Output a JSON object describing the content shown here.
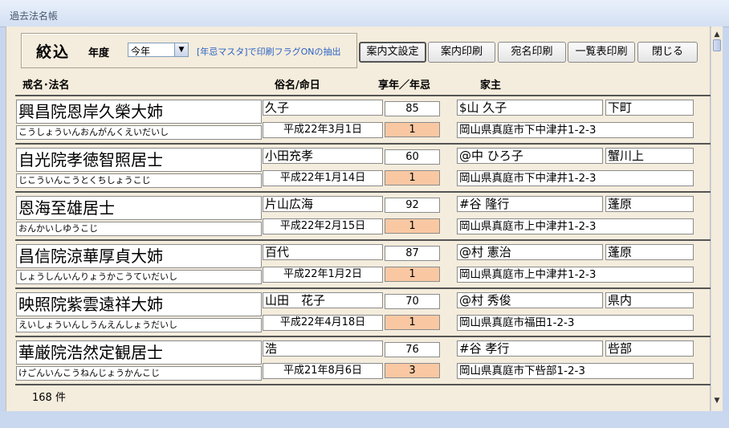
{
  "window": {
    "title": "過去法名帳"
  },
  "filter": {
    "title": "絞込",
    "year_label": "年度",
    "year_value": "今年",
    "link": "[年忌マスタ]で印刷フラグONの抽出"
  },
  "buttons": {
    "guide_settings": "案内文設定",
    "guide_print": "案内印刷",
    "address_print": "宛名印刷",
    "list_print": "一覧表印刷",
    "close": "閉じる"
  },
  "columns": {
    "kaimyo": "戒名･法名",
    "zokumyo": "俗名/命日",
    "age_nenki": "享年／年忌",
    "kachu": "家主"
  },
  "records": [
    {
      "kaimyo": "興昌院恩岸久榮大姉",
      "kana": "こうしょういんおんがんくえいだいし",
      "zokumyo": "久子",
      "meinichi": "平成22年3月1日",
      "age": "85",
      "nenki": "1",
      "kachu": "$山 久子",
      "area": "下町",
      "address": "岡山県真庭市下中津井1-2-3"
    },
    {
      "kaimyo": "自光院孝徳智照居士",
      "kana": "じこういんこうとくちしょうこじ",
      "zokumyo": "小田充孝",
      "meinichi": "平成22年1月14日",
      "age": "60",
      "nenki": "1",
      "kachu": "@中 ひろ子",
      "area": "蟹川上",
      "address": "岡山県真庭市下中津井1-2-3"
    },
    {
      "kaimyo": "恩海至雄居士",
      "kana": "おんかいしゆうこじ",
      "zokumyo": "片山広海",
      "meinichi": "平成22年2月15日",
      "age": "92",
      "nenki": "1",
      "kachu": "#谷 隆行",
      "area": "蓬原",
      "address": "岡山県真庭市上中津井1-2-3"
    },
    {
      "kaimyo": "昌信院涼華厚貞大姉",
      "kana": "しょうしんいんりょうかこうていだいし",
      "zokumyo": "百代",
      "meinichi": "平成22年1月2日",
      "age": "87",
      "nenki": "1",
      "kachu": "@村 憲治",
      "area": "蓬原",
      "address": "岡山県真庭市上中津井1-2-3"
    },
    {
      "kaimyo": "映照院紫雲遠祥大姉",
      "kana": "えいしょういんしうんえんしょうだいし",
      "zokumyo": "山田　花子",
      "meinichi": "平成22年4月18日",
      "age": "70",
      "nenki": "1",
      "kachu": "@村 秀俊",
      "area": "県内",
      "address": "岡山県真庭市福田1-2-3"
    },
    {
      "kaimyo": "華厳院浩然定観居士",
      "kana": "けごんいんこうねんじょうかんこじ",
      "zokumyo": "浩",
      "meinichi": "平成21年8月6日",
      "age": "76",
      "nenki": "3",
      "kachu": "#谷 孝行",
      "area": "呰部",
      "address": "岡山県真庭市下呰部1-2-3"
    }
  ],
  "footer": {
    "count": "168 件"
  },
  "colors": {
    "background": "#f4ecdc",
    "nenki_fill": "#f9c8a3",
    "link": "#2a62c8"
  }
}
